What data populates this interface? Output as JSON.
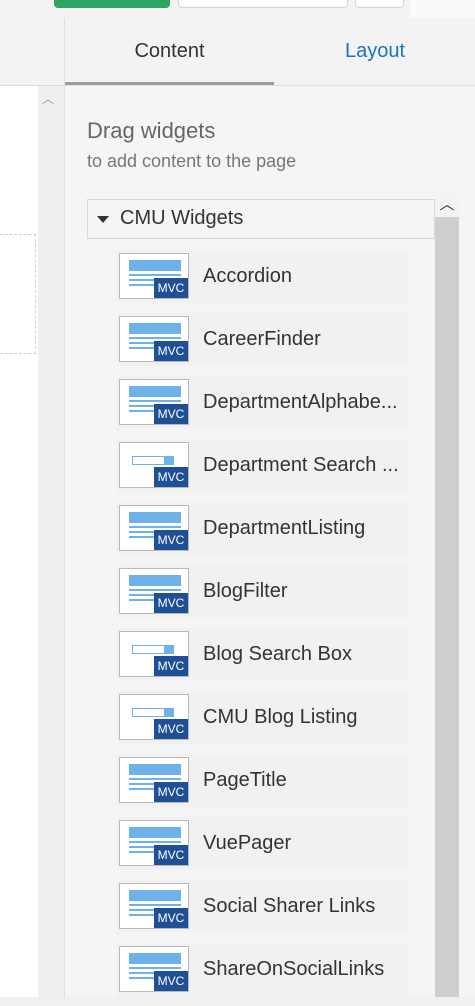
{
  "tabs": {
    "content": "Content",
    "layout": "Layout"
  },
  "drag": {
    "title": "Drag widgets",
    "subtitle": "to add content to the page"
  },
  "group": {
    "label": "CMU Widgets"
  },
  "widgets": [
    {
      "label": "Accordion",
      "icon": "layout-widget-icon",
      "badge": "MVC"
    },
    {
      "label": "CareerFinder",
      "icon": "layout-widget-icon",
      "badge": "MVC"
    },
    {
      "label": "DepartmentAlphabe...",
      "icon": "layout-widget-icon",
      "badge": "MVC"
    },
    {
      "label": "Department Search ...",
      "icon": "search-box-widget-icon",
      "badge": "MVC"
    },
    {
      "label": "DepartmentListing",
      "icon": "layout-widget-icon",
      "badge": "MVC"
    },
    {
      "label": "BlogFilter",
      "icon": "layout-widget-icon",
      "badge": "MVC"
    },
    {
      "label": "Blog Search Box",
      "icon": "search-box-widget-icon",
      "badge": "MVC"
    },
    {
      "label": "CMU Blog Listing",
      "icon": "search-box-widget-icon",
      "badge": "MVC"
    },
    {
      "label": "PageTitle",
      "icon": "layout-widget-icon",
      "badge": "MVC"
    },
    {
      "label": "VuePager",
      "icon": "layout-widget-icon",
      "badge": "MVC"
    },
    {
      "label": "Social Sharer Links",
      "icon": "layout-widget-icon",
      "badge": "MVC"
    },
    {
      "label": "ShareOnSocialLinks",
      "icon": "layout-widget-icon",
      "badge": "MVC"
    }
  ],
  "colors": {
    "accent": "#1a73c4",
    "publish": "#2ba561",
    "mvc_badge": "#1f4f95",
    "icon_blue": "#6fb1ea"
  }
}
